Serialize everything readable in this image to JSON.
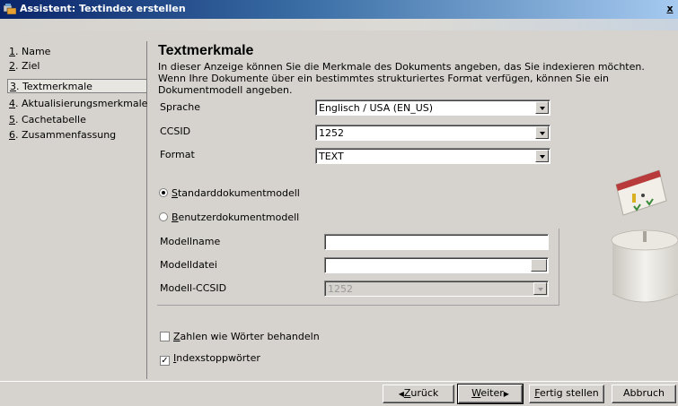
{
  "window": {
    "title": "Assistent: Textindex erstellen",
    "close_glyph": "x"
  },
  "sidebar": {
    "items": [
      {
        "num": "1",
        "label": ". Name"
      },
      {
        "num": "2",
        "label": ". Ziel"
      },
      {
        "num": "3",
        "label": ". Textmerkmale"
      },
      {
        "num": "4",
        "label": ". Aktualisierungsmerkmale"
      },
      {
        "num": "5",
        "label": ". Cachetabelle"
      },
      {
        "num": "6",
        "label": ". Zusammenfassung"
      }
    ]
  },
  "main": {
    "title": "Textmerkmale",
    "description": "In dieser Anzeige können Sie die Merkmale des Dokuments angeben, das Sie indexieren möchten. Wenn Ihre Dokumente über ein bestimmtes strukturiertes Format verfügen, können Sie ein Dokumentmodell angeben.",
    "sprache_label": "Sprache",
    "sprache_value": "Englisch / USA (EN_US)",
    "ccsid_label": "CCSID",
    "ccsid_value": "1252",
    "format_label": "Format",
    "format_value": "TEXT",
    "radio_standard_key": "S",
    "radio_standard_rest": "tandarddokumentmodell",
    "radio_benutzer_key": "B",
    "radio_benutzer_rest": "enutzerdokumentmodell",
    "modellname_label": "Modellname",
    "modellname_value": "",
    "modelldatei_label": "Modelldatei",
    "modelldatei_value": "",
    "modell_ccsid_label": "Modell-CCSID",
    "modell_ccsid_value": "1252",
    "zahlen_key": "Z",
    "zahlen_rest": "ahlen wie Wörter behandeln",
    "zahlen_checked": false,
    "index_key": "I",
    "index_rest": "ndexstoppwörter",
    "index_checked": true,
    "check_glyph": "✓"
  },
  "buttons": {
    "back_arrow": "◀",
    "back_key": "Z",
    "back_rest": "urück",
    "next_key": "W",
    "next_rest": "eiter",
    "next_arrow": "▶",
    "finish_key": "F",
    "finish_rest": "ertig stellen",
    "cancel": "Abbruch"
  }
}
